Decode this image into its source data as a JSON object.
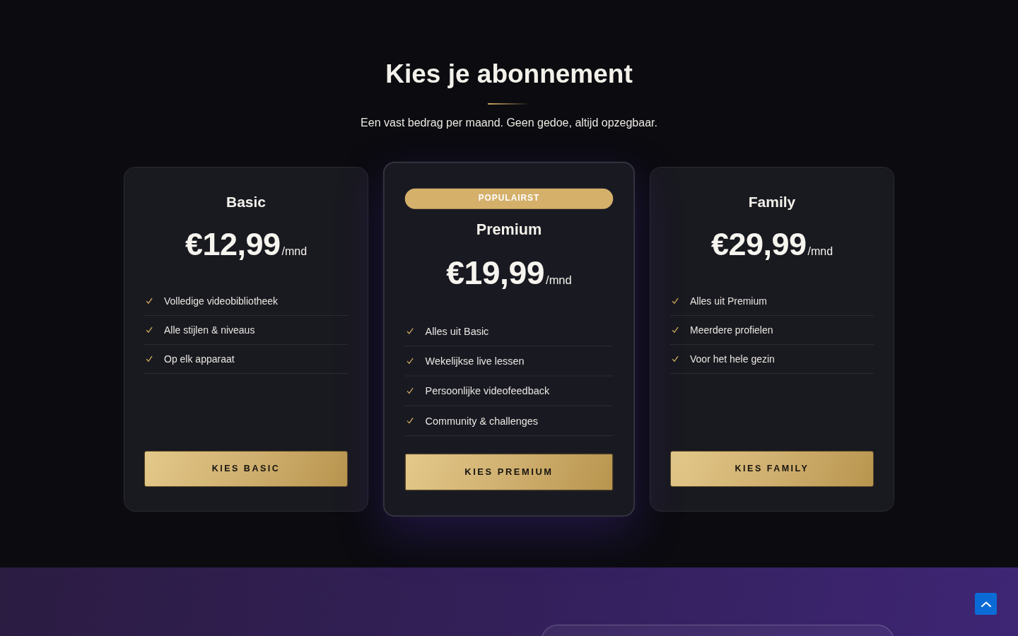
{
  "header": {
    "title": "Kies je abonnement",
    "subtitle": "Een vast bedrag per maand. Geen gedoe, altijd opzegbaar."
  },
  "plans": [
    {
      "name": "Basic",
      "featured": false,
      "price": "€12,99",
      "period": "/mnd",
      "features": [
        "Volledige videobibliotheek",
        "Alle stijlen & niveaus",
        "Op elk apparaat"
      ],
      "button": "KIES BASIC"
    },
    {
      "name": "Premium",
      "featured": true,
      "badge": "POPULAIRST",
      "price": "€19,99",
      "period": "/mnd",
      "features": [
        "Alles uit Basic",
        "Wekelijkse live lessen",
        "Persoonlijke videofeedback",
        "Community & challenges"
      ],
      "button": "KIES PREMIUM"
    },
    {
      "name": "Family",
      "featured": false,
      "price": "€29,99",
      "period": "/mnd",
      "features": [
        "Alles uit Premium",
        "Meerdere profielen",
        "Voor het hele gezin"
      ],
      "button": "KIES FAMILY"
    }
  ]
}
